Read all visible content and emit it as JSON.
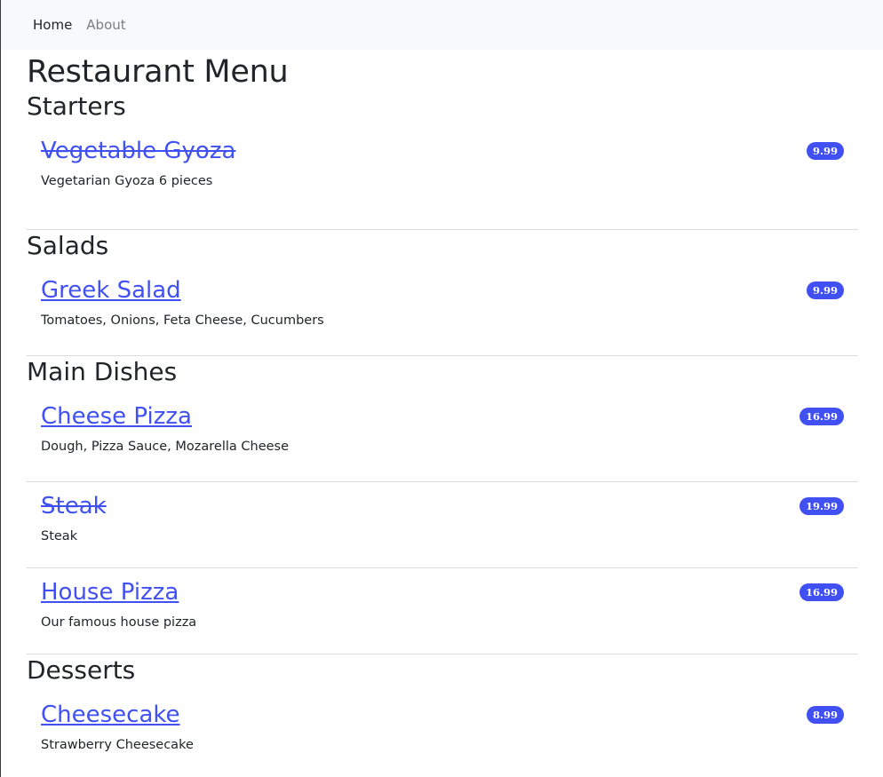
{
  "nav": {
    "home_label": "Home",
    "about_label": "About"
  },
  "page": {
    "title": "Restaurant Menu"
  },
  "colors": {
    "link": "#4150f2",
    "badge": "#4150f2",
    "navbar_bg": "#f8f9fa",
    "text": "#212529"
  },
  "categories": [
    {
      "title": "Starters",
      "items": [
        {
          "name": "Vegetable Gyoza",
          "price": "9.99",
          "description": "Vegetarian Gyoza 6 pieces",
          "unavailable": true
        }
      ]
    },
    {
      "title": "Salads",
      "items": [
        {
          "name": "Greek Salad",
          "price": "9.99",
          "description": "Tomatoes, Onions, Feta Cheese, Cucumbers",
          "unavailable": false
        }
      ]
    },
    {
      "title": "Main Dishes",
      "items": [
        {
          "name": "Cheese Pizza",
          "price": "16.99",
          "description": "Dough, Pizza Sauce, Mozarella Cheese",
          "unavailable": false
        },
        {
          "name": "Steak",
          "price": "19.99",
          "description": "Steak",
          "unavailable": true
        },
        {
          "name": "House Pizza",
          "price": "16.99",
          "description": "Our famous house pizza",
          "unavailable": false
        }
      ]
    },
    {
      "title": "Desserts",
      "items": [
        {
          "name": "Cheesecake",
          "price": "8.99",
          "description": "Strawberry Cheesecake",
          "unavailable": false
        }
      ]
    }
  ]
}
